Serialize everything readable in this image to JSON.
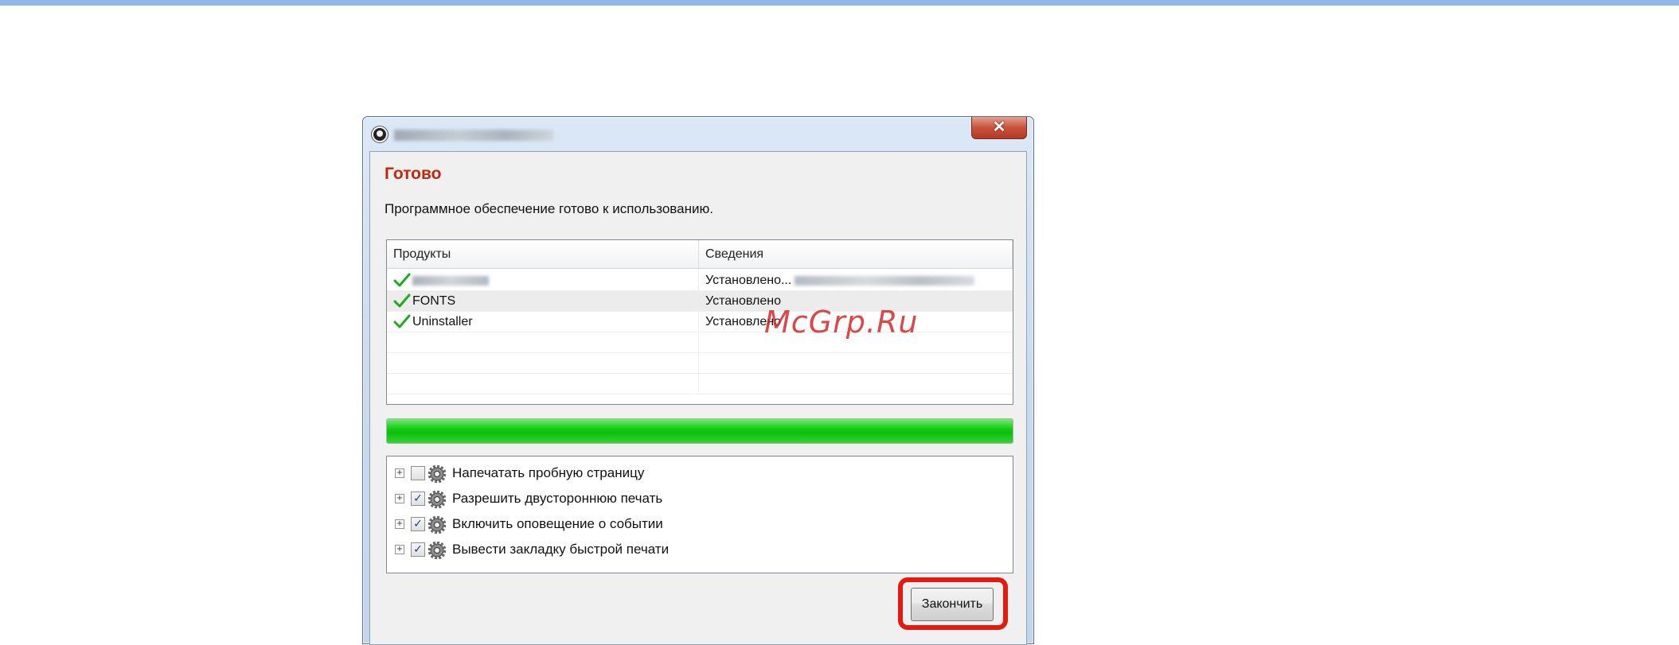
{
  "window": {
    "close_glyph": "✕"
  },
  "dialog": {
    "heading": "Готово",
    "subtitle": "Программное обеспечение готово к использованию."
  },
  "product_list": {
    "columns": [
      "Продукты",
      "Сведения"
    ],
    "rows": [
      {
        "name": "",
        "status": "Установлено..."
      },
      {
        "name": "FONTS",
        "status": "Установлено"
      },
      {
        "name": "Uninstaller",
        "status": "Установлено"
      }
    ]
  },
  "progress": {
    "value": 1.0,
    "color": "#1fcf1f"
  },
  "options": [
    {
      "expander": "+",
      "checked": false,
      "check_glyph": "",
      "label": "Напечатать пробную страницу"
    },
    {
      "expander": "+",
      "checked": true,
      "check_glyph": "✓",
      "label": "Разрешить двустороннюю печать"
    },
    {
      "expander": "+",
      "checked": true,
      "check_glyph": "✓",
      "label": "Включить оповещение о событии"
    },
    {
      "expander": "+",
      "checked": true,
      "check_glyph": "✓",
      "label": "Вывести закладку быстрой печати"
    }
  ],
  "finish_button": {
    "label": "Закончить",
    "highlight_color": "#e31a12"
  },
  "watermark": "McGrp.Ru",
  "colors": {
    "accent_bar": "#8fb6e8",
    "heading": "#c0280e",
    "check": "#1faa1f"
  }
}
